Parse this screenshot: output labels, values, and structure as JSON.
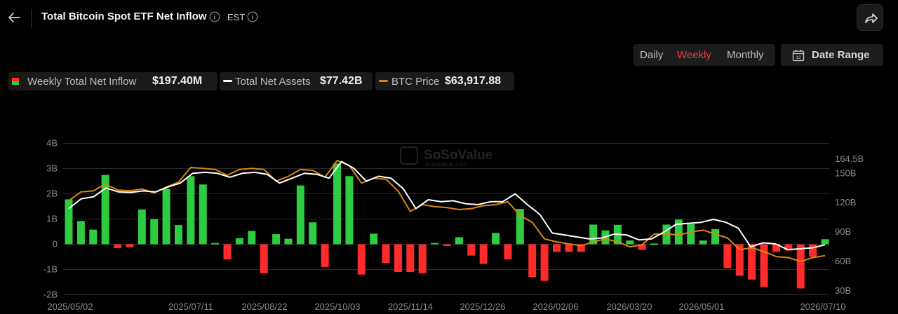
{
  "header": {
    "title": "Total Bitcoin Spot ETF Net Inflow",
    "timezone": "EST"
  },
  "period_tabs": [
    {
      "label": "Daily",
      "active": false
    },
    {
      "label": "Weekly",
      "active": true
    },
    {
      "label": "Monthly",
      "active": false
    }
  ],
  "date_range_label": "Date Range",
  "legend": {
    "inflow": {
      "name": "Weekly Total Net Inflow",
      "value": "$197.40M"
    },
    "assets": {
      "name": "Total Net Assets",
      "value": "$77.42B"
    },
    "price": {
      "name": "BTC Price",
      "value": "$63,917.88"
    }
  },
  "watermark": {
    "brand": "SoSoValue",
    "url": "sosovalue.com"
  },
  "colors": {
    "accent": "#ff3b30",
    "positive": "#2ecc40",
    "negative": "#ff2a2a",
    "assets_line": "#ffffff",
    "price_line": "#d9860f"
  },
  "chart_data": {
    "type": "bar",
    "title": "Total Bitcoin Spot ETF Net Inflow",
    "x_tick_labels": [
      "2025/05/02",
      "2025/07/11",
      "2025/08/22",
      "2025/10/03",
      "2025/11/14",
      "2025/12/26",
      "2026/02/06",
      "2026/03/20",
      "2026/05/01",
      "2026/07/10"
    ],
    "left_axis": {
      "ticks": [
        "-2B",
        "-1B",
        "0",
        "1B",
        "2B",
        "3B",
        "4B"
      ],
      "range": [
        -2,
        4
      ],
      "unit": "B"
    },
    "right_axis": {
      "ticks": [
        "30B",
        "60B",
        "90B",
        "120B",
        "150B",
        "164.5B"
      ],
      "range": [
        25,
        165
      ],
      "unit": "B"
    },
    "grid": true,
    "series": [
      {
        "name": "Weekly Total Net Inflow",
        "type": "bar",
        "axis": "left",
        "values": [
          1.78,
          0.92,
          0.58,
          2.75,
          -0.15,
          -0.12,
          1.38,
          1.0,
          2.2,
          0.76,
          2.7,
          2.37,
          0.05,
          -0.6,
          0.24,
          0.53,
          -1.15,
          0.4,
          0.22,
          2.33,
          0.87,
          -0.9,
          3.2,
          2.7,
          -1.2,
          0.42,
          -0.75,
          -1.1,
          -1.1,
          -1.15,
          0.05,
          -0.07,
          0.28,
          -0.45,
          -0.78,
          0.45,
          -0.6,
          1.4,
          -1.3,
          -1.45,
          -0.3,
          -0.3,
          -0.3,
          0.78,
          0.55,
          0.77,
          0.15,
          -0.22,
          0.03,
          0.78,
          0.98,
          0.8,
          0.15,
          0.6,
          -0.95,
          -1.25,
          -1.4,
          -1.7,
          -0.3,
          -0.25,
          -1.75,
          -0.5,
          0.2
        ]
      },
      {
        "name": "Total Net Assets",
        "type": "line",
        "axis": "right",
        "values": [
          114,
          124,
          126,
          135,
          131,
          130.5,
          132,
          131,
          136,
          140,
          150,
          151,
          150,
          146,
          150,
          151,
          149,
          140,
          145,
          150,
          149,
          145,
          162,
          155,
          142,
          147,
          145,
          134,
          114,
          123,
          121,
          122,
          119,
          118,
          121,
          121,
          129,
          118,
          108,
          89,
          87,
          85,
          83,
          84,
          88,
          87,
          82,
          83,
          90,
          98,
          99,
          100,
          103,
          100,
          94,
          75,
          79,
          78,
          72,
          73,
          74,
          77
        ]
      },
      {
        "name": "BTC Price",
        "type": "line",
        "axis": "right",
        "values": [
          122,
          131,
          132,
          139,
          133,
          132,
          134,
          130,
          136,
          141,
          156,
          155,
          154,
          148,
          154,
          155,
          154,
          142,
          147,
          154,
          153,
          146,
          163,
          158,
          140,
          145,
          144,
          132,
          111,
          118,
          116,
          115,
          113,
          114,
          117,
          118,
          121,
          107,
          100,
          83,
          80,
          78,
          76,
          80,
          83,
          80,
          75,
          77,
          88,
          88,
          87,
          90,
          92,
          88,
          84,
          72,
          74,
          70,
          65,
          64,
          60,
          64,
          66
        ]
      }
    ]
  }
}
